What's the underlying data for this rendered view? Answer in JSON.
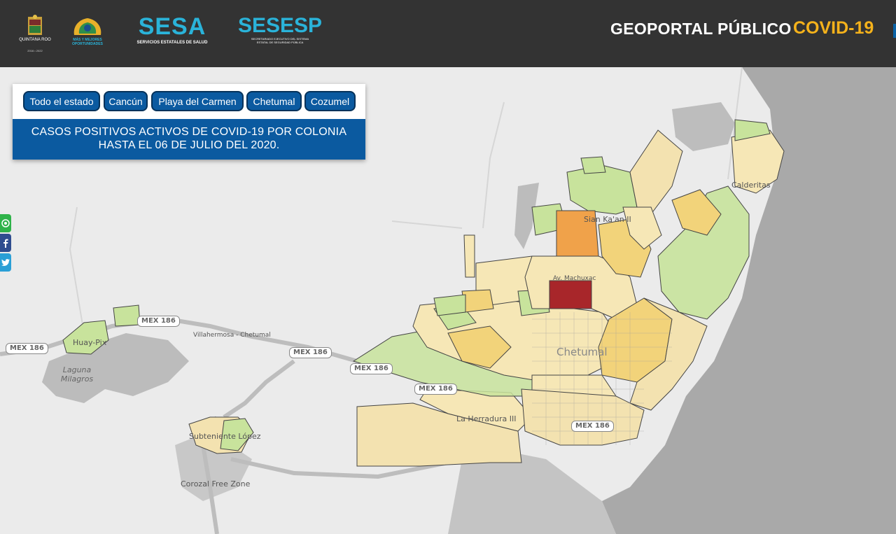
{
  "header": {
    "logo_qroo_text": "QUINTANA ROO",
    "logo_qroo_years": "2016 • 2022",
    "logo_mas_text": "MÁS Y MEJORES OPORTUNIDADES",
    "sesa_title": "SESA",
    "sesa_subtitle": "SERVICIOS ESTATALES DE SALUD",
    "sesesp_title": "SESESP",
    "sesesp_subtitle": "SECRETARIADO EJECUTIVO DEL SISTEMA ESTATAL DE SEGURIDAD PÚBLICA",
    "portal_title": "GEOPORTAL PÚBLICO",
    "covid_label": "COVID-19"
  },
  "panel": {
    "buttons": [
      "Todo el estado",
      "Cancún",
      "Playa del Carmen",
      "Chetumal",
      "Cozumel"
    ],
    "title_line1": "CASOS POSITIVOS ACTIVOS DE COVID-19 POR COLONIA",
    "title_line2": "HASTA EL 06 DE JULIO DEL 2020."
  },
  "social": [
    "whatsapp-icon",
    "facebook-icon",
    "twitter-icon"
  ],
  "map": {
    "places": [
      "Calderitas",
      "Sian Ka'an II",
      "Av. Machuxac",
      "Chetumal",
      "La Herradura III",
      "Huay-Pix",
      "Laguna Milagros",
      "Subteniente López",
      "Corozal Free Zone",
      "Villahermosa - Chetumal"
    ],
    "shields": [
      "MEX 186",
      "MEX 186",
      "MEX 186",
      "MEX 186",
      "MEX 186",
      "MEX 186"
    ],
    "colors": {
      "water": "#a8a8a8",
      "land": "#e8e8e8",
      "low": "#f6e7b6",
      "light": "#c8e39c",
      "medium": "#f2d37a",
      "high": "#f0a24a",
      "very_high": "#a8262a"
    }
  }
}
